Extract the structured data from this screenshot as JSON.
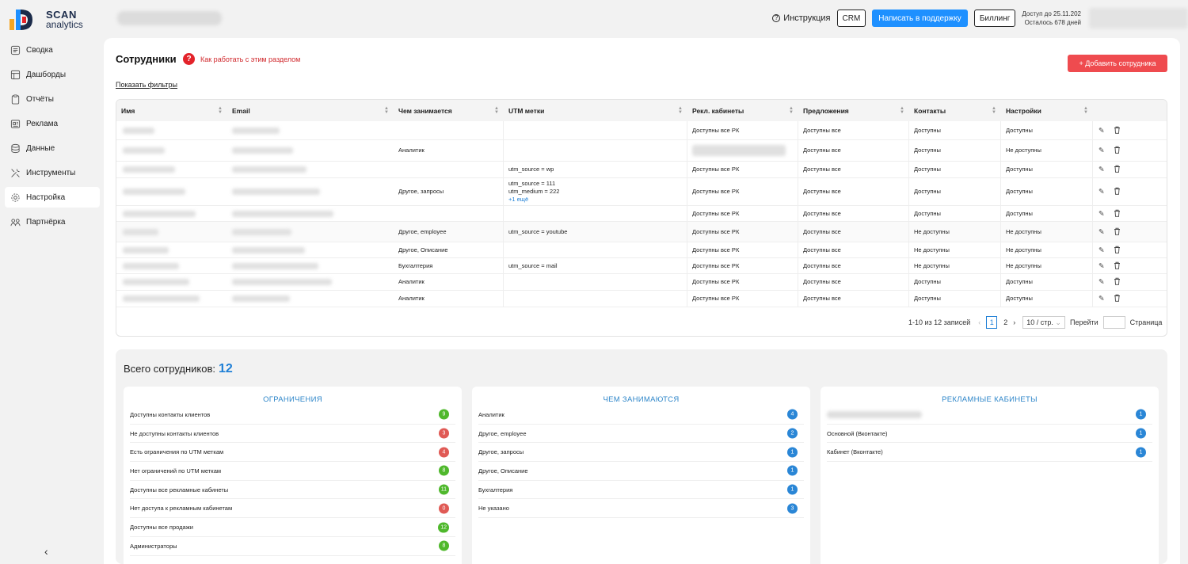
{
  "brand": {
    "line1": "SCAN",
    "line2": "analytics"
  },
  "header": {
    "instruction_label": "Инструкция",
    "crm_label": "CRM",
    "support_label": "Написать в поддержку",
    "billing_label": "Биллинг",
    "access_until": "Доступ до 25.11.202",
    "days_left": "Осталось 678 дней"
  },
  "sidebar": {
    "items": [
      {
        "label": "Сводка",
        "icon": "summary-icon"
      },
      {
        "label": "Дашборды",
        "icon": "dashboard-icon"
      },
      {
        "label": "Отчёты",
        "icon": "reports-icon"
      },
      {
        "label": "Реклама",
        "icon": "ads-icon"
      },
      {
        "label": "Данные",
        "icon": "database-icon"
      },
      {
        "label": "Инструменты",
        "icon": "tools-icon"
      },
      {
        "label": "Настройка",
        "icon": "gear-icon"
      },
      {
        "label": "Партнёрка",
        "icon": "partners-icon"
      }
    ],
    "active_index": 6,
    "collapse_label": "‹"
  },
  "page": {
    "title": "Сотрудники",
    "help_label": "Как работать с этим разделом",
    "add_button_label": "+ Добавить сотрудника",
    "filters_link": "Показать фильтры"
  },
  "table": {
    "columns": [
      "Имя",
      "Email",
      "Чем занимается",
      "UTM метки",
      "Рекл. кабинеты",
      "Предложения",
      "Контакты",
      "Настройки"
    ],
    "rows": [
      {
        "activity": "",
        "utm": [],
        "utm_more": "",
        "ads": "Доступны все РК",
        "offers": "Доступны все",
        "contacts": "Доступны",
        "settings": "Доступны"
      },
      {
        "activity": "Аналитик",
        "utm": [],
        "utm_more": "",
        "ads": "",
        "offers": "Доступны все",
        "contacts": "Доступны",
        "settings": "Не доступны"
      },
      {
        "activity": "",
        "utm": [
          "utm_source = wp"
        ],
        "utm_more": "",
        "ads": "Доступны все РК",
        "offers": "Доступны все",
        "contacts": "Доступны",
        "settings": "Доступны"
      },
      {
        "activity": "Другое, запросы",
        "utm": [
          "utm_source = 111",
          "utm_medium = 222"
        ],
        "utm_more": "+1 ещё",
        "ads": "Доступны все РК",
        "offers": "Доступны все",
        "contacts": "Доступны",
        "settings": "Доступны"
      },
      {
        "activity": "",
        "utm": [],
        "utm_more": "",
        "ads": "Доступны все РК",
        "offers": "Доступны все",
        "contacts": "Доступны",
        "settings": "Доступны"
      },
      {
        "activity": "Другое, employee",
        "utm": [
          "utm_source = youtube"
        ],
        "utm_more": "",
        "ads": "Доступны все РК",
        "offers": "Доступны все",
        "contacts": "Не доступны",
        "settings": "Не доступны"
      },
      {
        "activity": "Другое, Описание",
        "utm": [],
        "utm_more": "",
        "ads": "Доступны все РК",
        "offers": "Доступны все",
        "contacts": "Не доступны",
        "settings": "Не доступны"
      },
      {
        "activity": "Бухгалтерия",
        "utm": [
          "utm_source = mail"
        ],
        "utm_more": "",
        "ads": "Доступны все РК",
        "offers": "Доступны все",
        "contacts": "Не доступны",
        "settings": "Не доступны"
      },
      {
        "activity": "Аналитик",
        "utm": [],
        "utm_more": "",
        "ads": "Доступны все РК",
        "offers": "Доступны все",
        "contacts": "Доступны",
        "settings": "Доступны"
      },
      {
        "activity": "Аналитик",
        "utm": [],
        "utm_more": "",
        "ads": "Доступны все РК",
        "offers": "Доступны все",
        "contacts": "Доступны",
        "settings": "Доступны"
      }
    ],
    "pagination": {
      "range": "1-10 из 12 записей",
      "current": "1",
      "next_page": "2",
      "page_size": "10 / стр.",
      "goto_label": "Перейти",
      "page_label": "Страница"
    }
  },
  "summary": {
    "title": "Всего сотрудников:",
    "total": "12",
    "cards": [
      {
        "title": "ОГРАНИЧЕНИЯ",
        "items": [
          {
            "label": "Доступны контакты клиентов",
            "count": "9",
            "color": "#4fb82c"
          },
          {
            "label": "Не доступны контакты клиентов",
            "count": "3",
            "color": "#e05a55"
          },
          {
            "label": "Есть ограничения по UTM меткам",
            "count": "4",
            "color": "#e05a55"
          },
          {
            "label": "Нет ограничений по UTM меткам",
            "count": "8",
            "color": "#4fb82c"
          },
          {
            "label": "Доступны все рекламные кабинеты",
            "count": "11",
            "color": "#4fb82c"
          },
          {
            "label": "Нет доступа к рекламным кабинетам",
            "count": "0",
            "color": "#e05a55"
          },
          {
            "label": "Доступны все продажи",
            "count": "12",
            "color": "#4fb82c"
          },
          {
            "label": "Администраторы",
            "count": "8",
            "color": "#4fb82c"
          }
        ]
      },
      {
        "title": "ЧЕМ ЗАНИМАЮТСЯ",
        "items": [
          {
            "label": "Аналитик",
            "count": "4",
            "color": "#2a86d6"
          },
          {
            "label": "Другое, employee",
            "count": "2",
            "color": "#2a86d6"
          },
          {
            "label": "Другое, запросы",
            "count": "1",
            "color": "#2a86d6"
          },
          {
            "label": "Другое, Описание",
            "count": "1",
            "color": "#2a86d6"
          },
          {
            "label": "Бухгалтерия",
            "count": "1",
            "color": "#2a86d6"
          },
          {
            "label": "Не указано",
            "count": "3",
            "color": "#2a86d6"
          }
        ]
      },
      {
        "title": "РЕКЛАМНЫЕ КАБИНЕТЫ",
        "items": [
          {
            "label": "",
            "count": "1",
            "color": "#2a86d6"
          },
          {
            "label": "Основной (Вконтакте)",
            "count": "1",
            "color": "#2a86d6"
          },
          {
            "label": "Кабинет (Вконтакте)",
            "count": "1",
            "color": "#2a86d6"
          }
        ]
      }
    ]
  }
}
